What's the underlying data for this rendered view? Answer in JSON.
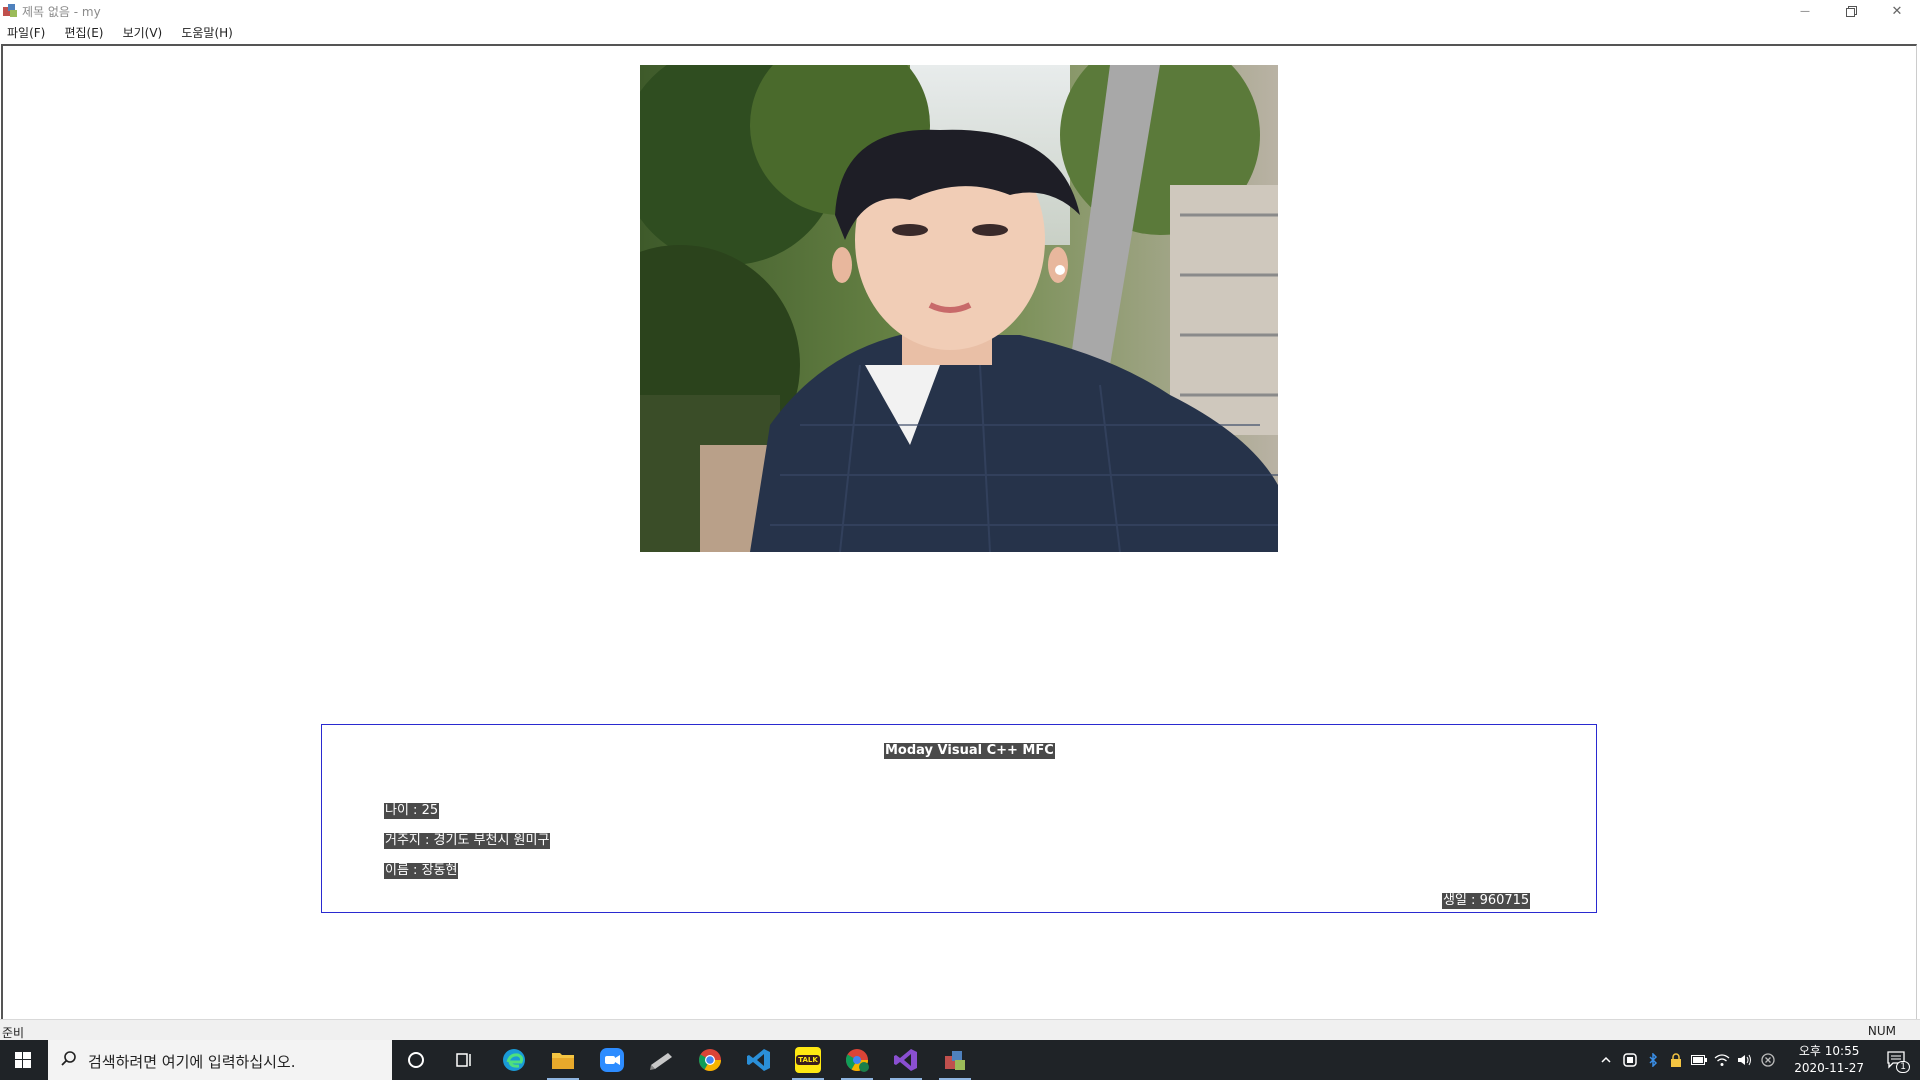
{
  "window": {
    "title": "제목 없음 - my",
    "minimize_glyph": "—",
    "close_glyph": "✕"
  },
  "menu": [
    {
      "label": "파일(F)"
    },
    {
      "label": "편집(E)"
    },
    {
      "label": "보기(V)"
    },
    {
      "label": "도움말(H)"
    }
  ],
  "content": {
    "photo_icon": "profile-photo",
    "heading": "Moday Visual C++ MFC",
    "age": "나이 : 25",
    "address": "거주지 : 경기도 부천시 원미구",
    "name": "이름 : 장동현",
    "birth": "생일 : 960715",
    "box_border_color": "#2a2ad0",
    "highlight_color": "#4a4a4a"
  },
  "statusbar": {
    "ready": "준비",
    "num": "NUM"
  },
  "taskbar": {
    "search_placeholder": "검색하려면 여기에 입력하십시오.",
    "apps": [
      {
        "name": "cortana-icon"
      },
      {
        "name": "task-view-icon"
      },
      {
        "name": "edge-icon"
      },
      {
        "name": "file-explorer-icon"
      },
      {
        "name": "zoom-icon"
      },
      {
        "name": "pen-app-icon"
      },
      {
        "name": "chrome-icon"
      },
      {
        "name": "vscode-icon"
      },
      {
        "name": "kakaotalk-icon"
      },
      {
        "name": "chrome-profile-icon"
      },
      {
        "name": "visual-studio-icon"
      },
      {
        "name": "mfc-app-icon"
      }
    ],
    "kakaotalk_label": "TALK",
    "clock_time": "오후 10:55",
    "clock_date": "2020-11-27",
    "notification_count": "1"
  }
}
